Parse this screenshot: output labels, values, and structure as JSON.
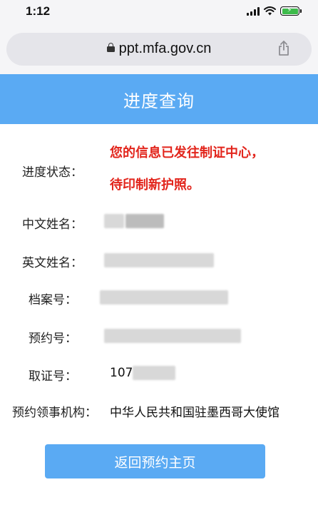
{
  "status_bar": {
    "time": "1:12",
    "icons": [
      "signal-icon",
      "wifi-icon",
      "battery-charging-icon"
    ]
  },
  "browser": {
    "url": "ppt.mfa.gov.cn",
    "lock_icon": "lock-icon",
    "share_icon": "share-icon"
  },
  "header": {
    "title": "进度查询",
    "background": "#5aaaf3"
  },
  "fields": {
    "status": {
      "label": "进度状态：",
      "line1": "您的信息已发往制证中心，",
      "line2": "待印制新护照。",
      "color": "#e2251c"
    },
    "chinese_name": {
      "label": "中文姓名："
    },
    "english_name": {
      "label": "英文姓名："
    },
    "file_number": {
      "label": "档案号："
    },
    "appointment_number": {
      "label": "预约号："
    },
    "pickup_number": {
      "label": "取证号：",
      "visible_prefix": "107"
    },
    "consulate": {
      "label": "预约领事机构：",
      "value": "中华人民共和国驻墨西哥大使馆"
    }
  },
  "button": {
    "label": "返回预约主页"
  }
}
